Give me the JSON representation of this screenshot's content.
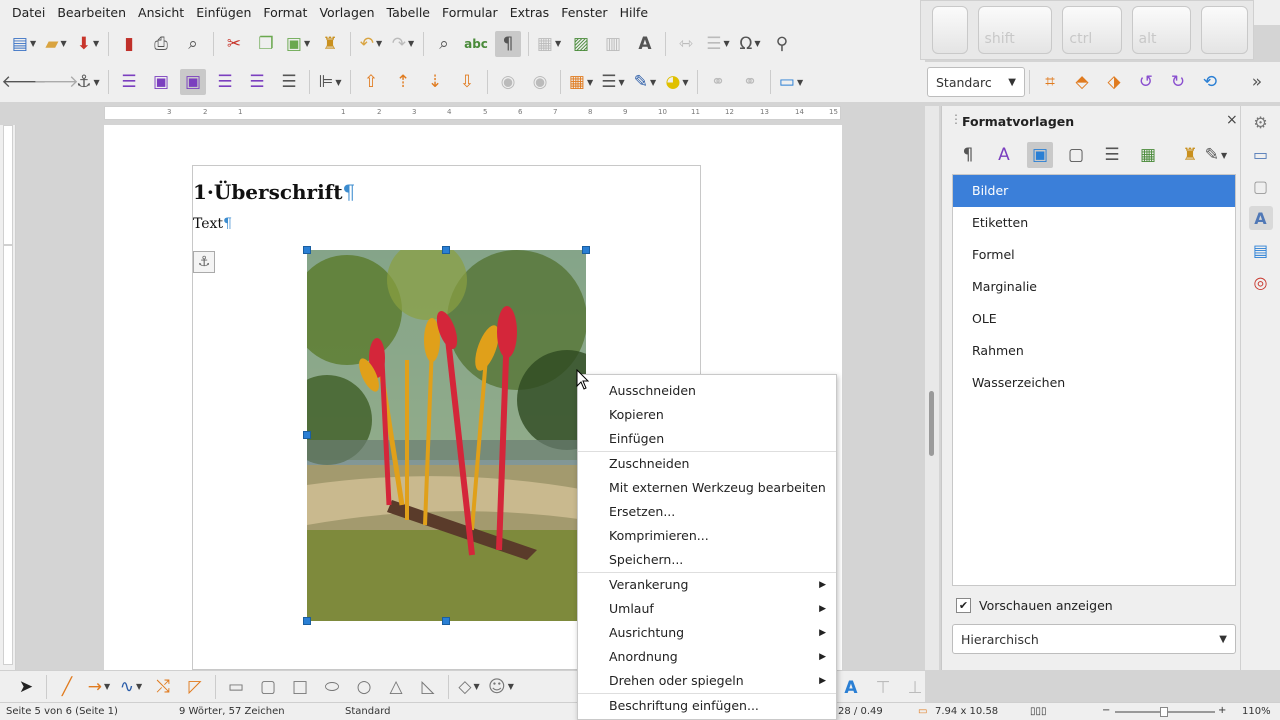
{
  "menubar": [
    "Datei",
    "Bearbeiten",
    "Ansicht",
    "Einfügen",
    "Format",
    "Vorlagen",
    "Tabelle",
    "Formular",
    "Extras",
    "Fenster",
    "Hilfe"
  ],
  "osk_keys": {
    "shift": "shift",
    "ctrl": "ctrl",
    "alt": "alt"
  },
  "style_combo": {
    "value": "Standarc"
  },
  "ruler_marks": [
    "3",
    "2",
    "1",
    "1",
    "2",
    "3",
    "4",
    "5",
    "6",
    "7",
    "8",
    "9",
    "10",
    "11",
    "12",
    "13",
    "14",
    "15"
  ],
  "document": {
    "heading": "1·Überschrift",
    "pilcrow": "¶",
    "body": "Text"
  },
  "sidebar": {
    "title": "Formatvorlagen",
    "styles": [
      "Bilder",
      "Etiketten",
      "Formel",
      "Marginalie",
      "OLE",
      "Rahmen",
      "Wasserzeichen"
    ],
    "selected_index": 0,
    "show_previews": "Vorschauen anzeigen",
    "filter": "Hierarchisch"
  },
  "context_menu": {
    "group1": [
      "Ausschneiden",
      "Kopieren",
      "Einfügen"
    ],
    "group2": [
      "Zuschneiden",
      "Mit externen Werkzeug bearbeiten",
      "Ersetzen...",
      "Komprimieren...",
      "Speichern..."
    ],
    "group3": [
      "Verankerung",
      "Umlauf",
      "Ausrichtung",
      "Anordnung",
      "Drehen oder spiegeln"
    ],
    "group4": [
      "Beschriftung einfügen..."
    ]
  },
  "statusbar": {
    "page": "Seite 5 von 6 (Seite 1)",
    "words": "9 Wörter, 57 Zeichen",
    "style": "Standard",
    "position": "28 / 0.49",
    "size": "7.94 x 10.58",
    "zoom": "110%"
  },
  "colors": {
    "selection": "#3b7fd9",
    "handle": "#2a7fd4",
    "accent": "#3c8ccf"
  }
}
